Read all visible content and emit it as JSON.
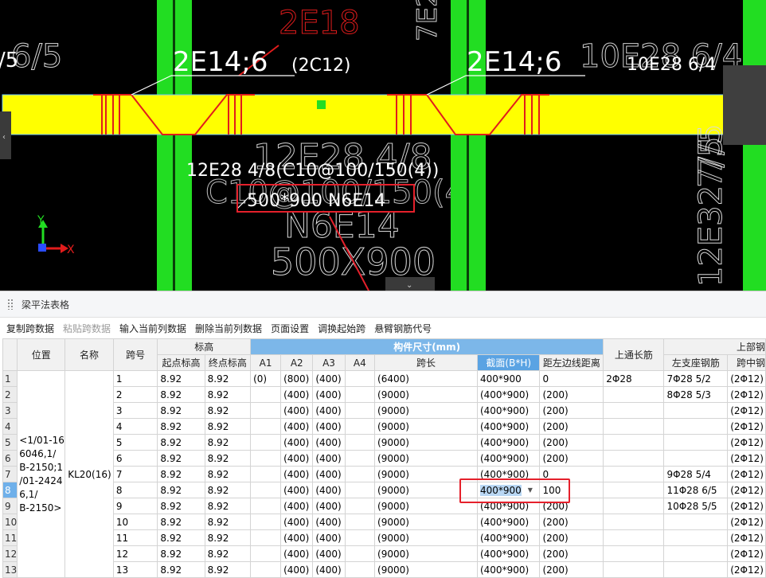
{
  "cad": {
    "labels": {
      "top_center": "2E18",
      "top_left_edge": "/5",
      "top_left_frac": "6/5",
      "beam_left": "2E14;6",
      "beam_left_sub": "(2C12)",
      "beam_right": "2E14;6",
      "top_right_ghost": "10E28 6/4",
      "top_right": "10E28 6/4",
      "top_vertical": "7E2",
      "annot_line1": "12E28 4/8(C10@100/150(4))",
      "annot_line2": "500*900 N6E14",
      "ghost_1": "12E28 4/8",
      "ghost_2": "C10@100/150(4)",
      "ghost_3": "N6E14",
      "ghost_4": "500X900",
      "right_vertical_1": "7/5",
      "right_vertical_2": "12E32 7/5"
    },
    "axis": {
      "y": "Y",
      "x": "X"
    },
    "colors": {
      "column": "#22dd22",
      "beam": "#ffff00",
      "rebar": "#e11c1c",
      "text": "#ffffff",
      "highlight": "#e5202b"
    }
  },
  "panel": {
    "title": "梁平法表格",
    "toolbar": [
      {
        "label": "复制跨数据",
        "enabled": true
      },
      {
        "label": "粘贴跨数据",
        "enabled": false
      },
      {
        "label": "输入当前列数据",
        "enabled": true
      },
      {
        "label": "删除当前列数据",
        "enabled": true
      },
      {
        "label": "页面设置",
        "enabled": true
      },
      {
        "label": "调换起始跨",
        "enabled": true
      },
      {
        "label": "悬臂钢筋代号",
        "enabled": true
      }
    ],
    "headers": {
      "position": "位置",
      "name": "名称",
      "span_no": "跨号",
      "elevation": "标高",
      "start_elev": "起点标高",
      "end_elev": "终点标高",
      "dims": "构件尺寸(mm)",
      "a1": "A1",
      "a2": "A2",
      "a3": "A3",
      "a4": "A4",
      "span_len": "跨长",
      "section": "截面(B*H)",
      "offset": "距左边线距离",
      "top_through": "上通长筋",
      "upper_rebar": "上部钢",
      "left_support": "左支座钢筋",
      "mid_span": "跨中钢"
    },
    "position_text": "<1/01-16\n6046,1/\nB-2150;1\n/01-2424\n6,1/\nB-2150>",
    "name_text": "KL20(16)",
    "selected_row": 8,
    "rows": [
      {
        "n": "1",
        "span": "1",
        "s": "8.92",
        "e": "8.92",
        "a1": "(0)",
        "a2": "(800)",
        "a3": "(400)",
        "a4": "",
        "len": "(6400)",
        "sec": "400*900",
        "off": "0",
        "top": "2Φ28",
        "left": "7Φ28 5/2",
        "mid": "(2Φ12)"
      },
      {
        "n": "2",
        "span": "2",
        "s": "8.92",
        "e": "8.92",
        "a1": "",
        "a2": "(400)",
        "a3": "(400)",
        "a4": "",
        "len": "(9000)",
        "sec": "(400*900)",
        "off": "(200)",
        "top": "",
        "left": "8Φ28 5/3",
        "mid": "(2Φ12)"
      },
      {
        "n": "3",
        "span": "3",
        "s": "8.92",
        "e": "8.92",
        "a1": "",
        "a2": "(400)",
        "a3": "(400)",
        "a4": "",
        "len": "(9000)",
        "sec": "(400*900)",
        "off": "(200)",
        "top": "",
        "left": "",
        "mid": "(2Φ12)"
      },
      {
        "n": "4",
        "span": "4",
        "s": "8.92",
        "e": "8.92",
        "a1": "",
        "a2": "(400)",
        "a3": "(400)",
        "a4": "",
        "len": "(9000)",
        "sec": "(400*900)",
        "off": "(200)",
        "top": "",
        "left": "",
        "mid": "(2Φ12)"
      },
      {
        "n": "5",
        "span": "5",
        "s": "8.92",
        "e": "8.92",
        "a1": "",
        "a2": "(400)",
        "a3": "(400)",
        "a4": "",
        "len": "(9000)",
        "sec": "(400*900)",
        "off": "(200)",
        "top": "",
        "left": "",
        "mid": "(2Φ12)"
      },
      {
        "n": "6",
        "span": "6",
        "s": "8.92",
        "e": "8.92",
        "a1": "",
        "a2": "(400)",
        "a3": "(400)",
        "a4": "",
        "len": "(9000)",
        "sec": "(400*900)",
        "off": "(200)",
        "top": "",
        "left": "",
        "mid": "(2Φ12)"
      },
      {
        "n": "7",
        "span": "7",
        "s": "8.92",
        "e": "8.92",
        "a1": "",
        "a2": "(400)",
        "a3": "(400)",
        "a4": "",
        "len": "(9000)",
        "sec": "(400*900)",
        "off": "0",
        "top": "",
        "left": "9Φ28 5/4",
        "mid": "(2Φ12)"
      },
      {
        "n": "8",
        "span": "8",
        "s": "8.92",
        "e": "8.92",
        "a1": "",
        "a2": "(400)",
        "a3": "(400)",
        "a4": "",
        "len": "(9000)",
        "sec": "400*900",
        "off": "100",
        "top": "",
        "left": "11Φ28 6/5",
        "mid": "(2Φ12)"
      },
      {
        "n": "9",
        "span": "9",
        "s": "8.92",
        "e": "8.92",
        "a1": "",
        "a2": "(400)",
        "a3": "(400)",
        "a4": "",
        "len": "(9000)",
        "sec": "(400*900)",
        "off": "(200)",
        "top": "",
        "left": "10Φ28 5/5",
        "mid": "(2Φ12)"
      },
      {
        "n": "10",
        "span": "10",
        "s": "8.92",
        "e": "8.92",
        "a1": "",
        "a2": "(400)",
        "a3": "(400)",
        "a4": "",
        "len": "(9000)",
        "sec": "(400*900)",
        "off": "(200)",
        "top": "",
        "left": "",
        "mid": "(2Φ12)"
      },
      {
        "n": "11",
        "span": "11",
        "s": "8.92",
        "e": "8.92",
        "a1": "",
        "a2": "(400)",
        "a3": "(400)",
        "a4": "",
        "len": "(9000)",
        "sec": "(400*900)",
        "off": "(200)",
        "top": "",
        "left": "",
        "mid": "(2Φ12)"
      },
      {
        "n": "12",
        "span": "12",
        "s": "8.92",
        "e": "8.92",
        "a1": "",
        "a2": "(400)",
        "a3": "(400)",
        "a4": "",
        "len": "(9000)",
        "sec": "(400*900)",
        "off": "(200)",
        "top": "",
        "left": "",
        "mid": "(2Φ12)"
      },
      {
        "n": "13",
        "span": "13",
        "s": "8.92",
        "e": "8.92",
        "a1": "",
        "a2": "(400)",
        "a3": "(400)",
        "a4": "",
        "len": "(9000)",
        "sec": "(400*900)",
        "off": "(200)",
        "top": "",
        "left": "",
        "mid": "(2Φ12)"
      }
    ]
  }
}
